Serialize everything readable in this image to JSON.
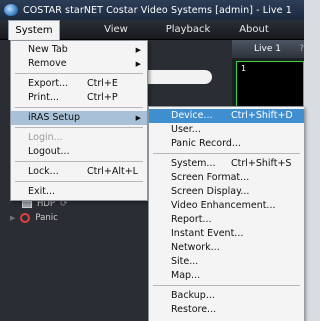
{
  "window": {
    "title": "COSTAR starNET Costar Video Systems [admin] - Live 1"
  },
  "menubar": {
    "system": "System",
    "view": "View",
    "playback": "Playback",
    "about": "About"
  },
  "system_menu": {
    "new_tab": "New Tab",
    "remove": "Remove",
    "export": "Export...",
    "export_shortcut": "Ctrl+E",
    "print": "Print...",
    "print_shortcut": "Ctrl+P",
    "iras_setup": "iRAS Setup",
    "login": "Login...",
    "logout": "Logout...",
    "lock": "Lock...",
    "lock_shortcut": "Ctrl+Alt+L",
    "exit": "Exit..."
  },
  "iras_submenu": {
    "device": "Device...",
    "device_shortcut": "Ctrl+Shift+D",
    "user": "User...",
    "panic_record": "Panic Record...",
    "system": "System...",
    "system_shortcut": "Ctrl+Shift+S",
    "screen_format": "Screen Format...",
    "screen_display": "Screen Display...",
    "video_enhancement": "Video Enhancement...",
    "report": "Report...",
    "instant_event": "Instant Event...",
    "network": "Network...",
    "site": "Site...",
    "map": "Map...",
    "backup": "Backup...",
    "restore": "Restore..."
  },
  "tree": {
    "hdp": "HDP",
    "panic": "Panic"
  },
  "live": {
    "tab": "Live 1",
    "cell_number": "1"
  },
  "colors": {
    "highlight": "#3f8ed0",
    "cell_border": "#3ad43a",
    "panic": "#e0413a"
  }
}
